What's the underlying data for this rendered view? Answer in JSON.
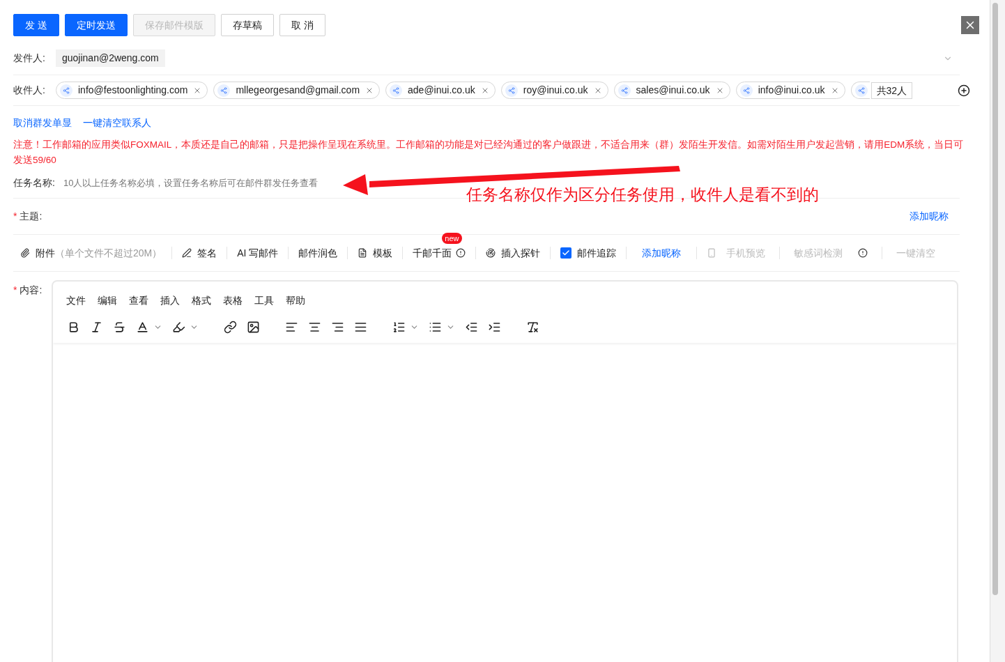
{
  "actions": [
    {
      "label": "发 送",
      "kind": "primary"
    },
    {
      "label": "定时发送",
      "kind": "primary"
    },
    {
      "label": "保存邮件模版",
      "kind": "disabled"
    },
    {
      "label": "存草稿",
      "kind": "default"
    },
    {
      "label": "取 消",
      "kind": "default"
    }
  ],
  "sender": {
    "label": "发件人:",
    "value": "guojinan@2weng.com"
  },
  "recipients": {
    "label": "收件人:",
    "items": [
      "info@festoonlighting.com",
      "mllegeorgesand@gmail.com",
      "ade@inui.co.uk",
      "roy@inui.co.uk",
      "sales@inui.co.uk",
      "info@inui.co.uk"
    ],
    "overflow": true,
    "total": "共32人"
  },
  "links": [
    "取消群发单显",
    "一键清空联系人"
  ],
  "warning": "注意！工作邮箱的应用类似FOXMAIL，本质还是自己的邮箱，只是把操作呈现在系统里。工作邮箱的功能是对已经沟通过的客户做跟进，不适合用来（群）发陌生开发信。如需对陌生用户发起营销，请用EDM系统，当日可发送59/60",
  "task": {
    "label": "任务名称:",
    "placeholder": "10人以上任务名称必填，设置任务名称后可在邮件群发任务查看"
  },
  "annotation": "任务名称仅作为区分任务使用，收件人是看不到的",
  "subject": {
    "required": "*",
    "label": "主题:",
    "link": "添加昵称"
  },
  "toolbar": [
    {
      "kind": "icon-text",
      "label": "附件",
      "hint": "（单个文件不超过20M）"
    },
    {
      "kind": "icon-text",
      "label": "签名"
    },
    {
      "kind": "text",
      "label": "AI 写邮件"
    },
    {
      "kind": "text",
      "label": "邮件润色"
    },
    {
      "kind": "icon-text",
      "label": "模板"
    },
    {
      "kind": "info",
      "label": "千邮千面",
      "badge": "new"
    },
    {
      "kind": "icon-text",
      "label": "插入探针"
    },
    {
      "kind": "checkbox",
      "label": "邮件追踪",
      "checked": true
    },
    {
      "kind": "link",
      "label": "添加昵称"
    },
    {
      "kind": "disabled",
      "label": "手机预览"
    },
    {
      "kind": "disabled-info",
      "label": "敏感词检测"
    },
    {
      "kind": "disabled",
      "label": "一键清空"
    }
  ],
  "content": {
    "required": "*",
    "label": "内容:",
    "menu": [
      "文件",
      "编辑",
      "查看",
      "插入",
      "格式",
      "表格",
      "工具",
      "帮助"
    ]
  }
}
